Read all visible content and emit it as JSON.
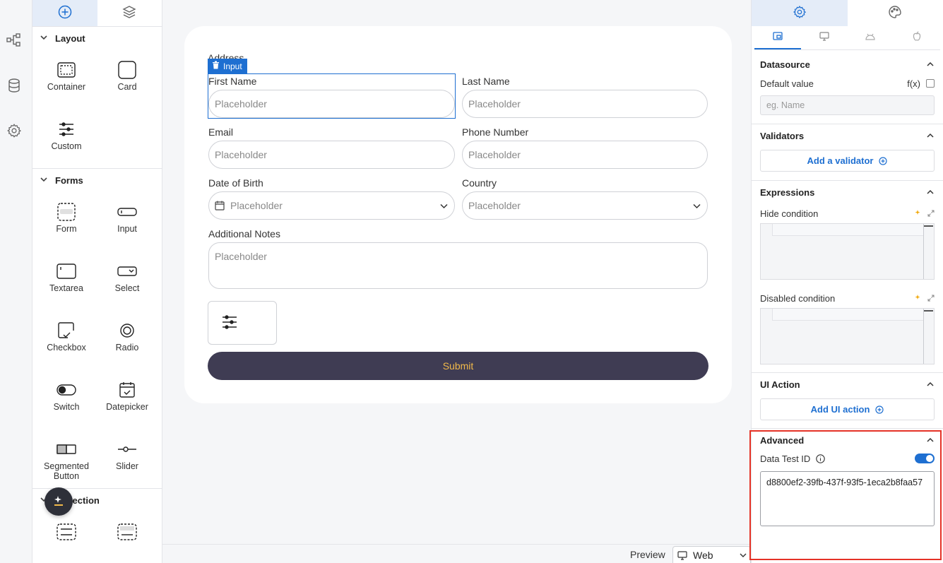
{
  "components": {
    "sections": [
      {
        "title": "Layout",
        "items": [
          {
            "label": "Container",
            "icon": "container-icon"
          },
          {
            "label": "Card",
            "icon": "card-icon"
          },
          {
            "label": "Custom",
            "icon": "sliders-icon"
          }
        ]
      },
      {
        "title": "Forms",
        "items": [
          {
            "label": "Form",
            "icon": "form-icon"
          },
          {
            "label": "Input",
            "icon": "input-icon"
          },
          {
            "label": "Textarea",
            "icon": "textarea-icon"
          },
          {
            "label": "Select",
            "icon": "select-icon"
          },
          {
            "label": "Checkbox",
            "icon": "checkbox-icon"
          },
          {
            "label": "Radio",
            "icon": "radio-icon"
          },
          {
            "label": "Switch",
            "icon": "switch-icon"
          },
          {
            "label": "Datepicker",
            "icon": "calendar-icon"
          },
          {
            "label": "Segmented Button",
            "icon": "segmented-button-icon"
          },
          {
            "label": "Slider",
            "icon": "slider-icon"
          }
        ]
      },
      {
        "title": "Collection",
        "items": []
      }
    ]
  },
  "form": {
    "title": "Address",
    "selected_tag": "Input",
    "fields": {
      "first_name": {
        "label": "First Name",
        "placeholder": "Placeholder"
      },
      "last_name": {
        "label": "Last Name",
        "placeholder": "Placeholder"
      },
      "email": {
        "label": "Email",
        "placeholder": "Placeholder"
      },
      "phone": {
        "label": "Phone Number",
        "placeholder": "Placeholder"
      },
      "dob": {
        "label": "Date of Birth",
        "placeholder": "Placeholder"
      },
      "country": {
        "label": "Country",
        "placeholder": "Placeholder"
      },
      "notes": {
        "label": "Additional Notes",
        "placeholder": "Placeholder"
      }
    },
    "submit_label": "Submit"
  },
  "bottom_bar": {
    "preview_label": "Preview",
    "platform": "Web"
  },
  "properties": {
    "datasource": {
      "title": "Datasource",
      "default_value_label": "Default value",
      "fx_label": "f(x)",
      "placeholder": "eg. Name"
    },
    "validators": {
      "title": "Validators",
      "add_label": "Add a validator"
    },
    "expressions": {
      "title": "Expressions",
      "hide_label": "Hide condition",
      "disabled_label": "Disabled condition"
    },
    "ui_action": {
      "title": "UI Action",
      "add_label": "Add UI action"
    },
    "advanced": {
      "title": "Advanced",
      "test_id_label": "Data Test ID",
      "test_id_enabled": true,
      "test_id_value": "d8800ef2-39fb-437f-93f5-1eca2b8faa57"
    }
  },
  "colors": {
    "accent": "#1e6fd1",
    "submit_bg": "#3f3c53",
    "submit_text": "#f1b94a",
    "highlight": "#e53226"
  }
}
